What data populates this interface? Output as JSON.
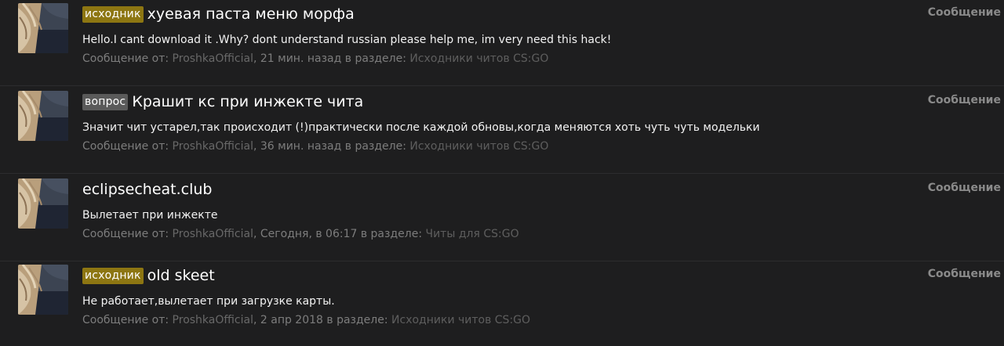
{
  "results": [
    {
      "prefix": "исходник",
      "prefix_type": "source",
      "title": "хуевая паста меню морфа",
      "snippet": "Hello.I cant download it .Why? dont understand russian please help me, im very need this hack!",
      "meta_prefix": "Сообщение от: ",
      "author": "ProshkaOfficial",
      "time_text": ", 21 мин. назад в разделе: ",
      "forum": "Исходники читов CS:GO",
      "type_label": "Сообщение"
    },
    {
      "prefix": "вопрос",
      "prefix_type": "question",
      "title": "Крашит кс при инжекте чита",
      "snippet": "Значит чит устарел,так происходит (!)практически после каждой обновы,когда меняются хоть чуть чуть модельки",
      "meta_prefix": "Сообщение от: ",
      "author": "ProshkaOfficial",
      "time_text": ", 36 мин. назад в разделе: ",
      "forum": "Исходники читов CS:GO",
      "type_label": "Сообщение"
    },
    {
      "prefix": "",
      "prefix_type": "",
      "title": "eclipsecheat.club",
      "snippet": "Вылетает при инжекте",
      "meta_prefix": "Сообщение от: ",
      "author": "ProshkaOfficial",
      "time_text": ", Сегодня, в 06:17 в разделе: ",
      "forum": "Читы для CS:GO",
      "type_label": "Сообщение"
    },
    {
      "prefix": "исходник",
      "prefix_type": "source",
      "title": "old skeet",
      "snippet": "Не работает,вылетает при загрузке карты.",
      "meta_prefix": "Сообщение от: ",
      "author": "ProshkaOfficial",
      "time_text": ", 2 апр 2018 в разделе: ",
      "forum": "Исходники читов CS:GO",
      "type_label": "Сообщение"
    }
  ],
  "colors": {
    "background": "#1e1e1f",
    "prefix_source": "#8d7612",
    "prefix_question": "#5a5a5a",
    "meta_text": "#7d7d7d"
  }
}
